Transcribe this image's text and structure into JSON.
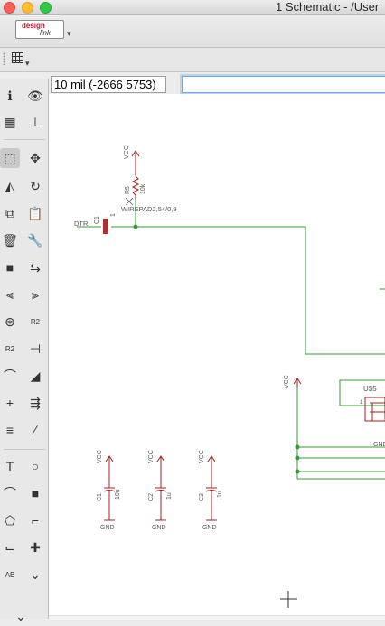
{
  "window": {
    "title": "1 Schematic - /User"
  },
  "toolbar": {
    "logo_line1": "design",
    "logo_line2": "link",
    "dropdown_glyph": "▾"
  },
  "coordinate_display": "10 mil (-2666 5753)",
  "command_input": {
    "value": "",
    "placeholder": ""
  },
  "left_toolbar": {
    "tools": [
      {
        "name": "info-icon",
        "glyph": "ℹ"
      },
      {
        "name": "eye-icon",
        "glyph": "👁"
      },
      {
        "name": "layers-icon",
        "glyph": "▦"
      },
      {
        "name": "mark-icon",
        "glyph": "⊥"
      },
      {
        "name": "select-group-icon",
        "glyph": "⬚"
      },
      {
        "name": "move-icon",
        "glyph": "✥"
      },
      {
        "name": "mirror-icon",
        "glyph": "◭"
      },
      {
        "name": "rotate-icon",
        "glyph": "↻"
      },
      {
        "name": "copy-icon",
        "glyph": "⧉"
      },
      {
        "name": "paste-icon",
        "glyph": "📋"
      },
      {
        "name": "delete-icon",
        "glyph": "🗑"
      },
      {
        "name": "wrench-icon",
        "glyph": "🔧"
      },
      {
        "name": "add-part-icon",
        "glyph": "■"
      },
      {
        "name": "replace-icon",
        "glyph": "⇆"
      },
      {
        "name": "split-icon",
        "glyph": "⫷"
      },
      {
        "name": "gate-swap-icon",
        "glyph": "⫸"
      },
      {
        "name": "smash-icon",
        "glyph": "⊛"
      },
      {
        "name": "value-icon",
        "glyph": "R2"
      },
      {
        "name": "value-menu-icon",
        "glyph": "R2"
      },
      {
        "name": "pin-swap-icon",
        "glyph": "⊣"
      },
      {
        "name": "miter-icon",
        "glyph": "⌒"
      },
      {
        "name": "split-line-icon",
        "glyph": "◢"
      },
      {
        "name": "optimize-icon",
        "glyph": "+"
      },
      {
        "name": "invoke-icon",
        "glyph": "⇶"
      },
      {
        "name": "align-icon",
        "glyph": "≡"
      },
      {
        "name": "wire-icon",
        "glyph": "∕"
      },
      {
        "name": "text-icon",
        "glyph": "T"
      },
      {
        "name": "circle-icon",
        "glyph": "○"
      },
      {
        "name": "arc-icon",
        "glyph": "⌒"
      },
      {
        "name": "rect-icon",
        "glyph": "■"
      },
      {
        "name": "polygon-icon",
        "glyph": "⬠"
      },
      {
        "name": "bus-icon",
        "glyph": "⌐"
      },
      {
        "name": "net-icon",
        "glyph": "⌙"
      },
      {
        "name": "junction-icon",
        "glyph": "✚"
      },
      {
        "name": "label-icon",
        "glyph": "AB"
      },
      {
        "name": "more-icon",
        "glyph": "⌄"
      }
    ]
  },
  "schematic": {
    "labels": {
      "vcc": "VCC",
      "gnd": "GND",
      "r_name": "R5",
      "r_value": "10k",
      "pad": "WIREPAD2,54/0,9",
      "c1_top": "C1",
      "c1_pin": "1",
      "dtr": "DTR",
      "c1": "C1",
      "c1_val": "10u",
      "c2": "C2",
      "c2_val": "1u",
      "c3": "C3",
      "c3_val": ".1u",
      "u5": "U$5",
      "u5_pin": "1"
    },
    "colors": {
      "wire": "#3a9a3a",
      "part": "#a02020",
      "text": "#555555",
      "pad": "#b03030"
    }
  }
}
